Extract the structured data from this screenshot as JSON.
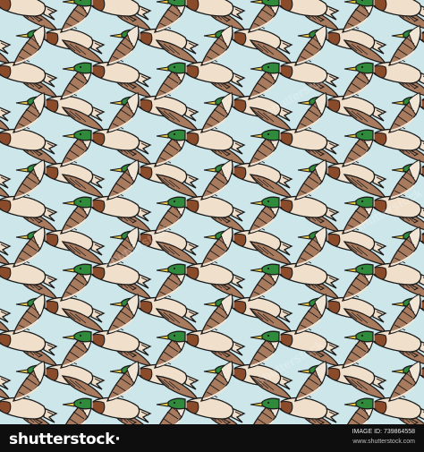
{
  "image": {
    "subject": "seamless pattern of flying mallard ducks",
    "colors": {
      "background": "#cde6ea",
      "outline": "#1a1a1a",
      "wing_brown": "#a87a5e",
      "wing_tip": "#f1e6d6",
      "body_cream": "#efdfcb",
      "head_green": "#2f8a3c",
      "neck_ring": "#ffffff",
      "chest_brown": "#8a4b2b",
      "beak_yellow": "#e5c646",
      "tail_dark": "#3a2a22"
    },
    "watermark_text": "shutterstock"
  },
  "footer": {
    "brand": "shutterstock",
    "brand_suffix": "·",
    "image_id": "IMAGE ID: 739864558",
    "site": "www.shutterstock.com"
  }
}
